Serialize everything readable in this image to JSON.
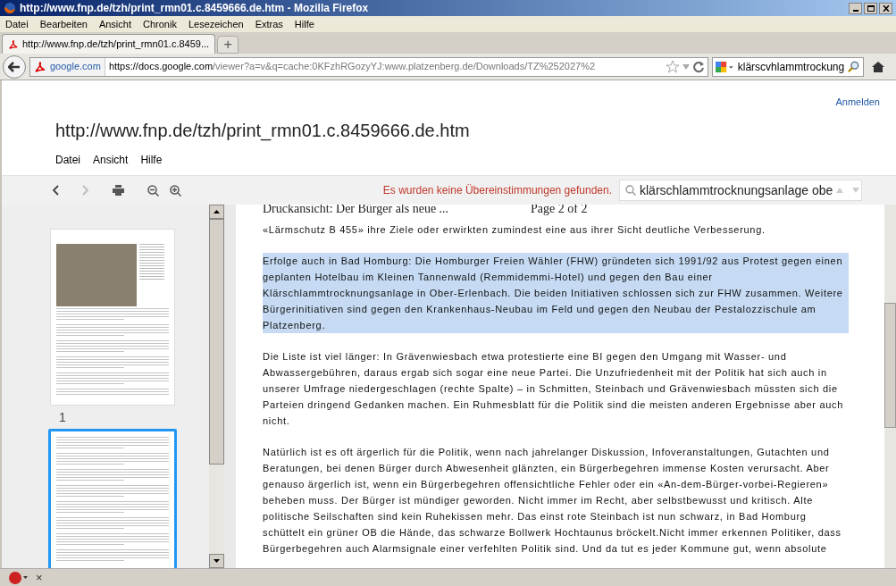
{
  "window": {
    "title": "http://www.fnp.de/tzh/print_rmn01.c.8459666.de.htm - Mozilla Firefox"
  },
  "menu": [
    "Datei",
    "Bearbeiten",
    "Ansicht",
    "Chronik",
    "Lesezeichen",
    "Extras",
    "Hilfe"
  ],
  "tabs": [
    {
      "label": "http://www.fnp.de/tzh/print_rmn01.c.8459...",
      "selected": true
    }
  ],
  "new_tab": "+",
  "navbar": {
    "site": "google.com",
    "url_host": "https://docs.google.com",
    "url_rest": "/viewer?a=v&q=cache:0KFzhRGozyYJ:www.platzenberg.de/Downloads/TZ%252027%2",
    "search_value": "klärscvhlammtrockung"
  },
  "viewer": {
    "signin": "Anmelden",
    "doc_title": "http://www.fnp.de/tzh/print_rmn01.c.8459666.de.htm",
    "menus": [
      "Datei",
      "Ansicht",
      "Hilfe"
    ],
    "find_message": "Es wurden keine Übereinstimmungen gefunden.",
    "find_value": "klärschlammtrocknungsanlage obe",
    "thumbnails": [
      {
        "label": "1",
        "selected": false
      },
      {
        "selected": true
      }
    ],
    "page": {
      "header_left": "Druckansicht: Der Bürger als neue ...",
      "header_right": "Page 2 of 2",
      "paragraphs": [
        {
          "text": "«Lärmschutz B 455» ihre Ziele oder erwirkten zumindest eine aus ihrer Sicht deutliche Verbesserung.",
          "highlighted": false
        },
        {
          "text": "Erfolge auch in Bad Homburg: Die Homburger Freien Wähler (FHW) gründeten sich 1991/92 aus Protest gegen einen geplanten Hotelbau im Kleinen Tannenwald (Remmidemmi-Hotel) und gegen den Bau einer Klärschlammtrocknungsanlage in Ober-Erlenbach. Die beiden Initiativen schlossen sich zur FHW zusammen. Weitere Bürgerinitiativen sind gegen den Krankenhaus-Neubau im Feld und gegen den Neubau der Pestalozzischule am Platzenberg.",
          "highlighted": true
        },
        {
          "text": "Die Liste ist viel länger: In Grävenwiesbach etwa protestierte eine BI gegen den Umgang mit Wasser- und Abwassergebühren, daraus ergab sich sogar eine neue Partei. Die Unzufriedenheit mit der Politik hat sich auch in unserer Umfrage niedergeschlagen (rechte Spalte) – in Schmitten, Steinbach und Grävenwiesbach müssten sich die Parteien dringend Gedanken machen. Ein Ruhmesblatt für die Politik sind die meisten anderen Ergebnisse aber auch nicht.",
          "highlighted": false
        },
        {
          "text": "Natürlich ist es oft ärgerlich für die Politik, wenn nach jahrelanger Diskussion, Infoveranstaltungen, Gutachten und Beratungen, bei denen Bürger durch Abwesenheit glänzten, ein Bürgerbegehren immense Kosten verursacht. Aber genauso ärgerlich ist, wenn ein Bürgerbegehren offensichtliche Fehler oder ein «An-dem-Bürger-vorbei-Regieren» beheben muss. Der Bürger ist mündiger geworden. Nicht immer im Recht, aber selbstbewusst und kritisch. Alte politische Seilschaften sind kein Ruhekissen mehr. Das einst rote Steinbach ist nun schwarz, in Bad Homburg schüttelt ein grüner OB die Hände, das schwarze Bollwerk Hochtaunus bröckelt.Nicht immer erkennen Politiker, dass Bürgerbegehren auch Alarmsignale einer verfehlten Politik sind. Und da tut es jeder Kommune gut, wenn absolute",
          "highlighted": false
        }
      ]
    }
  },
  "status_bar": {
    "close": "×"
  }
}
